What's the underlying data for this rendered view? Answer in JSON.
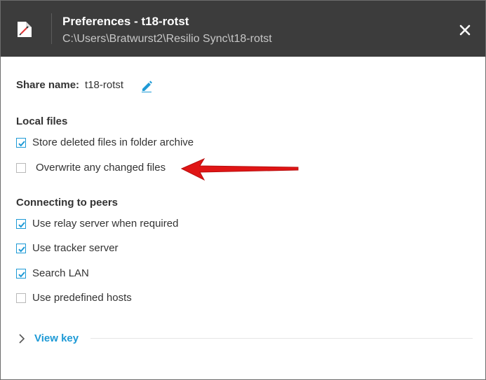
{
  "window": {
    "title": "Preferences - t18-rotst",
    "path": "C:\\Users\\Bratwurst2\\Resilio Sync\\t18-rotst",
    "folder_icon": "folder-icon",
    "close_icon": "close-icon"
  },
  "share": {
    "label": "Share name:",
    "value": "t18-rotst",
    "edit_icon": "pencil-icon"
  },
  "local_files": {
    "heading": "Local files",
    "options": [
      {
        "label": "Store deleted files in folder archive",
        "checked": true
      },
      {
        "label": "Overwrite any changed files",
        "checked": false
      }
    ]
  },
  "peers": {
    "heading": "Connecting to peers",
    "options": [
      {
        "label": "Use relay server when required",
        "checked": true
      },
      {
        "label": "Use tracker server",
        "checked": true
      },
      {
        "label": "Search LAN",
        "checked": true
      },
      {
        "label": "Use predefined hosts",
        "checked": false
      }
    ]
  },
  "view_key": {
    "label": "View key"
  },
  "colors": {
    "titlebar": "#3c3c3c",
    "accent": "#1e9ad6",
    "annotation_arrow": "#e01515"
  }
}
